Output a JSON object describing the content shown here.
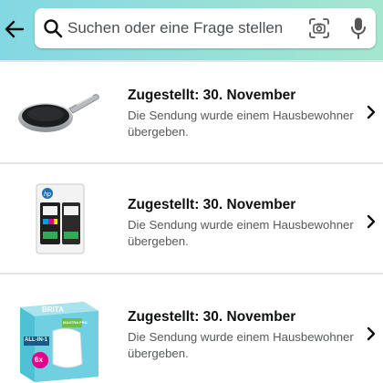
{
  "search": {
    "placeholder": "Suchen oder eine Frage stellen"
  },
  "header": {
    "gradient_start": "#84d8e3",
    "gradient_end": "#a5e6cf"
  },
  "icons": {
    "back": "arrow-left-icon",
    "search": "search-icon",
    "camera": "camera-scan-icon",
    "mic": "microphone-icon",
    "chevron": "chevron-right-icon"
  },
  "orders": [
    {
      "status": "Zugestellt: 30. November",
      "detail": "Die Sendung wurde einem Hausbewohner übergeben."
    },
    {
      "status": "Zugestellt: 30. November",
      "detail": "Die Sendung wurde einem Hausbewohner übergeben."
    },
    {
      "status": "Zugestellt: 30. November",
      "detail": "Die Sendung wurde einem Hausbewohner übergeben.",
      "product_labels": {
        "brand": "BRITA",
        "pack": "ALL-IN-1",
        "count": "6x",
        "line": "MAXTRA PRO"
      }
    }
  ],
  "colors": {
    "text_primary": "#0f1111",
    "text_secondary": "#565959",
    "divider": "#e3e6e6"
  }
}
